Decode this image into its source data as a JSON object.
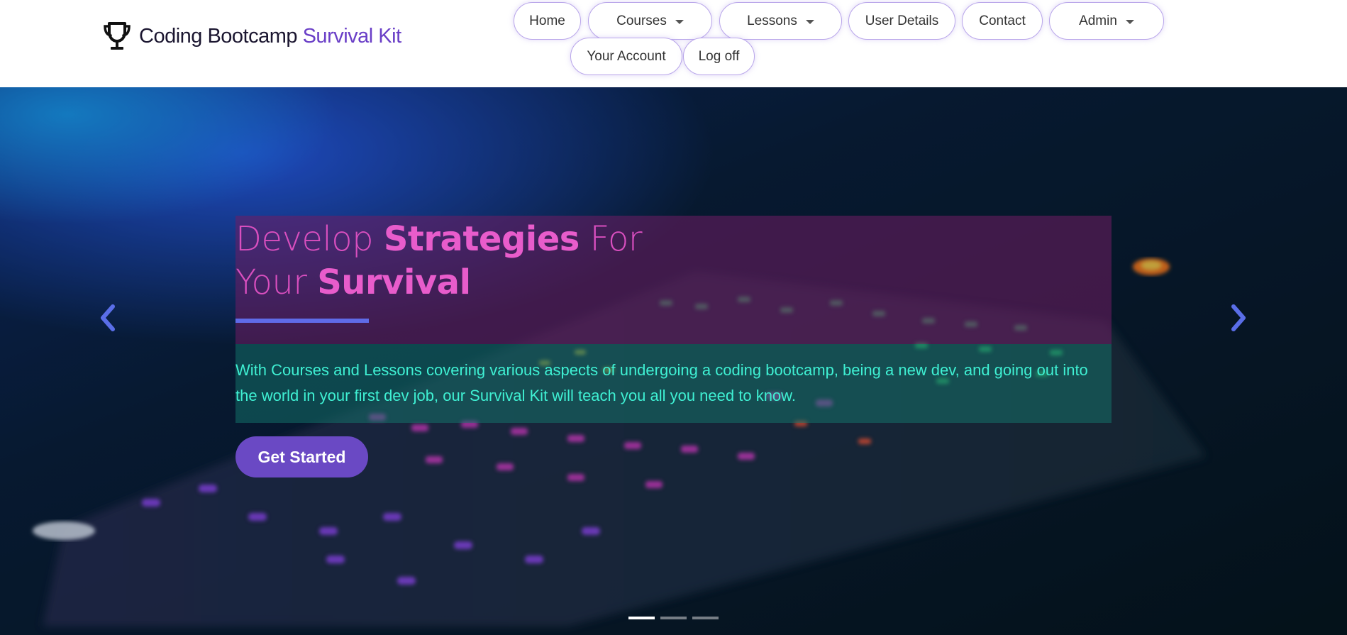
{
  "brand": {
    "icon": "trophy-icon",
    "name_part1": "Coding Bootcamp",
    "name_part2": "Survival Kit",
    "accent_color": "#6a3fc7"
  },
  "nav": {
    "home": "Home",
    "courses": "Courses",
    "lessons": "Lessons",
    "user_details": "User Details",
    "contact": "Contact",
    "admin": "Admin",
    "your_account": "Your Account",
    "log_off": "Log off"
  },
  "hero": {
    "headline": {
      "part1": "Develop ",
      "part2": "Strategies",
      "part3": " For",
      "part4": "Your ",
      "part5": "Survival"
    },
    "description": "With Courses and Lessons covering various aspects of undergoing a coding bootcamp, being a new dev, and going out into the world in your first dev job, our Survival Kit will teach you all you need to know.",
    "cta_label": "Get Started",
    "prev_icon": "chevron-left-icon",
    "next_icon": "chevron-right-icon",
    "slides_total": 3,
    "active_slide": 1,
    "colors": {
      "headline": "#d94fbf",
      "description": "#3ff0d3",
      "cta_background": "#6a49c4",
      "rule": "#5f6be8"
    }
  }
}
